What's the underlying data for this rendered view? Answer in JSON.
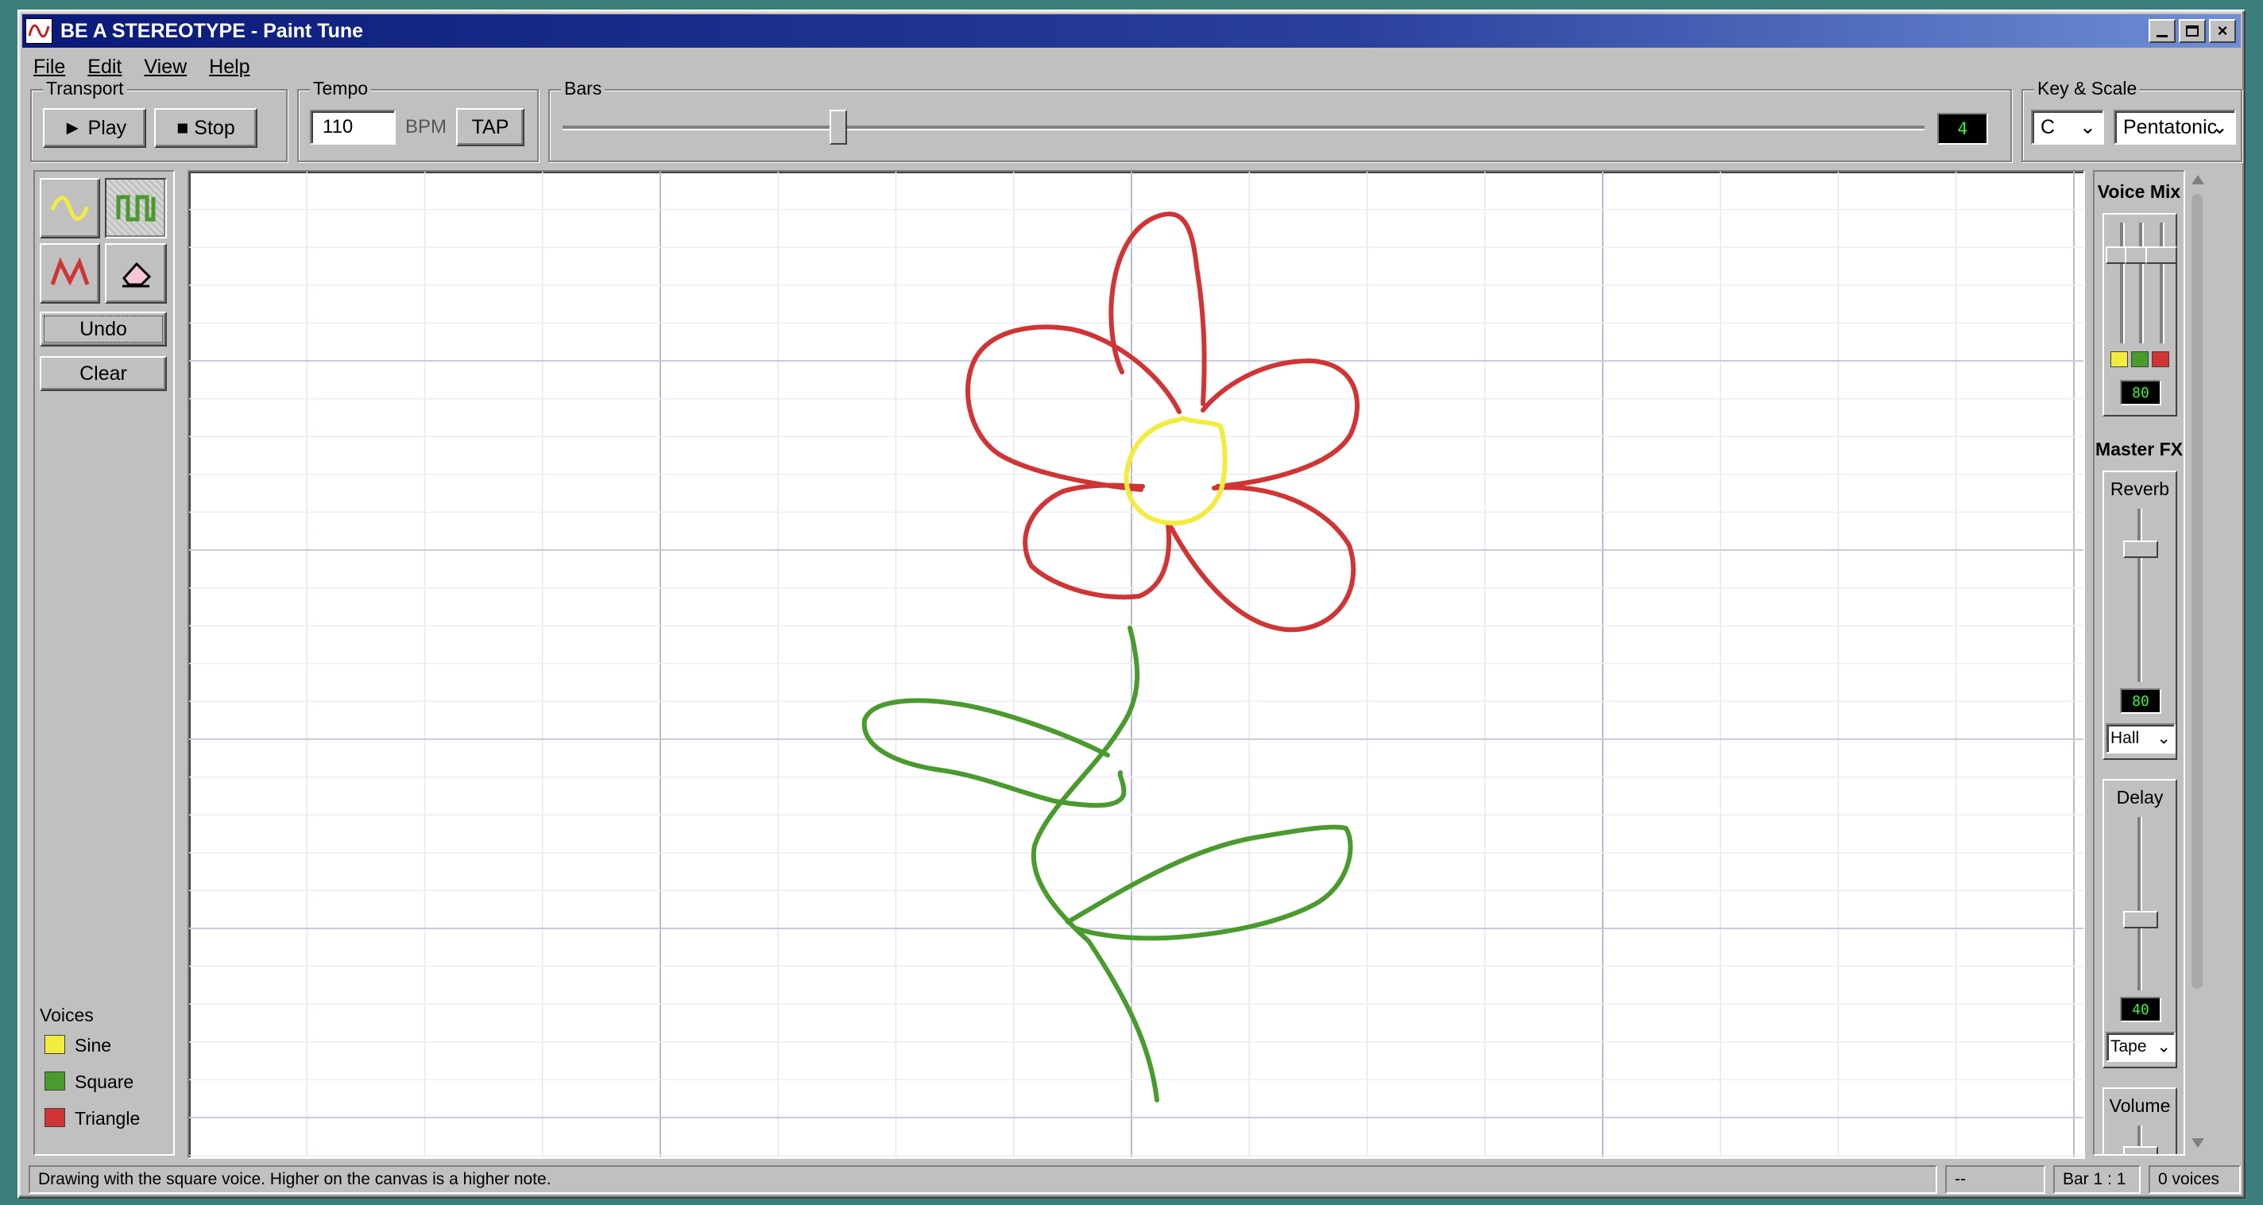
{
  "window": {
    "title": "BE A STEREOTYPE - Paint Tune"
  },
  "menu": [
    {
      "label": "File"
    },
    {
      "label": "Edit"
    },
    {
      "label": "View"
    },
    {
      "label": "Help"
    }
  ],
  "transport": {
    "label": "Transport",
    "play": "► Play",
    "stop": "■ Stop"
  },
  "tempo": {
    "label": "Tempo",
    "value": "110",
    "unit": "BPM",
    "tap": "TAP"
  },
  "bars": {
    "label": "Bars",
    "value": "4",
    "slider_fraction": 0.25
  },
  "key_scale": {
    "label": "Key & Scale",
    "key": "C",
    "scale": "Pentatonic"
  },
  "tools": {
    "undo": "Undo",
    "clear": "Clear",
    "voices_label": "Voices",
    "voices": [
      {
        "name": "Sine",
        "color": "#f2ec3f"
      },
      {
        "name": "Square",
        "color": "#4a9a2e"
      },
      {
        "name": "Triangle",
        "color": "#d03434"
      }
    ]
  },
  "mixer": {
    "title": "Voice Mix",
    "value": "80",
    "fx_title": "Master FX",
    "reverb": {
      "label": "Reverb",
      "value": "80",
      "type": "Hall"
    },
    "delay": {
      "label": "Delay",
      "value": "40",
      "type": "Tape"
    },
    "volume": {
      "label": "Volume"
    }
  },
  "status": {
    "message": "Drawing with the square voice. Higher on the canvas is a higher note.",
    "note": "--",
    "position": "Bar 1 : 1",
    "voices": "0 voices"
  },
  "colors": {
    "sine": "#f2ec3f",
    "square": "#4a9a2e",
    "triangle": "#d03434",
    "title_bar": "#0a1a7a"
  }
}
